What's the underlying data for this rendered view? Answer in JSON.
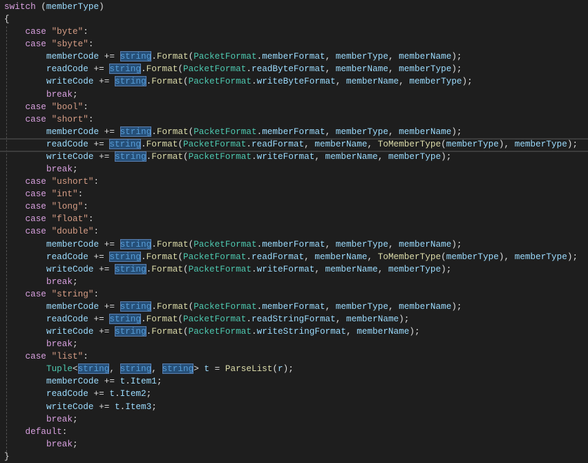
{
  "editor": {
    "lines": [
      {
        "i": 0,
        "t": [
          [
            "switch",
            "kw"
          ],
          [
            " (",
            "p"
          ],
          [
            "memberType",
            "var"
          ],
          [
            ")",
            "p"
          ]
        ]
      },
      {
        "i": 0,
        "t": [
          [
            "{",
            "p"
          ]
        ]
      },
      {
        "i": 4,
        "t": [
          [
            "case",
            "kw"
          ],
          [
            " ",
            "p"
          ],
          [
            "\"byte\"",
            "str"
          ],
          [
            ":",
            "p"
          ]
        ]
      },
      {
        "i": 4,
        "t": [
          [
            "case",
            "kw"
          ],
          [
            " ",
            "p"
          ],
          [
            "\"sbyte\"",
            "str"
          ],
          [
            ":",
            "p"
          ]
        ]
      },
      {
        "i": 8,
        "t": [
          [
            "memberCode",
            "var"
          ],
          [
            " += ",
            "p"
          ],
          [
            "string",
            "hl"
          ],
          [
            ".",
            "p"
          ],
          [
            "Format",
            "fn"
          ],
          [
            "(",
            "p"
          ],
          [
            "PacketFormat",
            "type"
          ],
          [
            ".",
            "p"
          ],
          [
            "memberFormat",
            "var"
          ],
          [
            ", ",
            "p"
          ],
          [
            "memberType",
            "var"
          ],
          [
            ", ",
            "p"
          ],
          [
            "memberName",
            "var"
          ],
          [
            ");",
            "p"
          ]
        ]
      },
      {
        "i": 8,
        "t": [
          [
            "readCode",
            "var"
          ],
          [
            " += ",
            "p"
          ],
          [
            "string",
            "hl"
          ],
          [
            ".",
            "p"
          ],
          [
            "Format",
            "fn"
          ],
          [
            "(",
            "p"
          ],
          [
            "PacketFormat",
            "type"
          ],
          [
            ".",
            "p"
          ],
          [
            "readByteFormat",
            "var"
          ],
          [
            ", ",
            "p"
          ],
          [
            "memberName",
            "var"
          ],
          [
            ", ",
            "p"
          ],
          [
            "memberType",
            "var"
          ],
          [
            ");",
            "p"
          ]
        ]
      },
      {
        "i": 8,
        "t": [
          [
            "writeCode",
            "var"
          ],
          [
            " += ",
            "p"
          ],
          [
            "string",
            "hl"
          ],
          [
            ".",
            "p"
          ],
          [
            "Format",
            "fn"
          ],
          [
            "(",
            "p"
          ],
          [
            "PacketFormat",
            "type"
          ],
          [
            ".",
            "p"
          ],
          [
            "writeByteFormat",
            "var"
          ],
          [
            ", ",
            "p"
          ],
          [
            "memberName",
            "var"
          ],
          [
            ", ",
            "p"
          ],
          [
            "memberType",
            "var"
          ],
          [
            ");",
            "p"
          ]
        ]
      },
      {
        "i": 8,
        "t": [
          [
            "break",
            "kw"
          ],
          [
            ";",
            "p"
          ]
        ]
      },
      {
        "i": 4,
        "t": [
          [
            "case",
            "kw"
          ],
          [
            " ",
            "p"
          ],
          [
            "\"bool\"",
            "str"
          ],
          [
            ":",
            "p"
          ]
        ]
      },
      {
        "i": 4,
        "t": [
          [
            "case",
            "kw"
          ],
          [
            " ",
            "p"
          ],
          [
            "\"short\"",
            "str"
          ],
          [
            ":",
            "p"
          ]
        ]
      },
      {
        "i": 8,
        "t": [
          [
            "memberCode",
            "var"
          ],
          [
            " += ",
            "p"
          ],
          [
            "string",
            "hl"
          ],
          [
            ".",
            "p"
          ],
          [
            "Format",
            "fn"
          ],
          [
            "(",
            "p"
          ],
          [
            "PacketFormat",
            "type"
          ],
          [
            ".",
            "p"
          ],
          [
            "memberFormat",
            "var"
          ],
          [
            ", ",
            "p"
          ],
          [
            "memberType",
            "var"
          ],
          [
            ", ",
            "p"
          ],
          [
            "memberName",
            "var"
          ],
          [
            ");",
            "p"
          ]
        ]
      },
      {
        "i": 8,
        "cur": true,
        "t": [
          [
            "readCode",
            "var"
          ],
          [
            " += ",
            "p"
          ],
          [
            "string",
            "hl"
          ],
          [
            ".",
            "p"
          ],
          [
            "Format",
            "fn"
          ],
          [
            "(",
            "p"
          ],
          [
            "PacketFormat",
            "type"
          ],
          [
            ".",
            "p"
          ],
          [
            "readFormat",
            "var"
          ],
          [
            ", ",
            "p"
          ],
          [
            "memberName",
            "var"
          ],
          [
            ", ",
            "p"
          ],
          [
            "ToMemberType",
            "fn"
          ],
          [
            "(",
            "p"
          ],
          [
            "memberType",
            "var"
          ],
          [
            "), ",
            "p"
          ],
          [
            "memberType",
            "var"
          ],
          [
            ");",
            "p"
          ]
        ]
      },
      {
        "i": 8,
        "t": [
          [
            "writeCode",
            "var"
          ],
          [
            " += ",
            "p"
          ],
          [
            "string",
            "hl"
          ],
          [
            ".",
            "p"
          ],
          [
            "Format",
            "fn"
          ],
          [
            "(",
            "p"
          ],
          [
            "PacketFormat",
            "type"
          ],
          [
            ".",
            "p"
          ],
          [
            "writeFormat",
            "var"
          ],
          [
            ", ",
            "p"
          ],
          [
            "memberName",
            "var"
          ],
          [
            ", ",
            "p"
          ],
          [
            "memberType",
            "var"
          ],
          [
            ");",
            "p"
          ]
        ]
      },
      {
        "i": 8,
        "t": [
          [
            "break",
            "kw"
          ],
          [
            ";",
            "p"
          ]
        ]
      },
      {
        "i": 4,
        "t": [
          [
            "case",
            "kw"
          ],
          [
            " ",
            "p"
          ],
          [
            "\"ushort\"",
            "str"
          ],
          [
            ":",
            "p"
          ]
        ]
      },
      {
        "i": 4,
        "t": [
          [
            "case",
            "kw"
          ],
          [
            " ",
            "p"
          ],
          [
            "\"int\"",
            "str"
          ],
          [
            ":",
            "p"
          ]
        ]
      },
      {
        "i": 4,
        "t": [
          [
            "case",
            "kw"
          ],
          [
            " ",
            "p"
          ],
          [
            "\"long\"",
            "str"
          ],
          [
            ":",
            "p"
          ]
        ]
      },
      {
        "i": 4,
        "t": [
          [
            "case",
            "kw"
          ],
          [
            " ",
            "p"
          ],
          [
            "\"float\"",
            "str"
          ],
          [
            ":",
            "p"
          ]
        ]
      },
      {
        "i": 4,
        "t": [
          [
            "case",
            "kw"
          ],
          [
            " ",
            "p"
          ],
          [
            "\"double\"",
            "str"
          ],
          [
            ":",
            "p"
          ]
        ]
      },
      {
        "i": 8,
        "t": [
          [
            "memberCode",
            "var"
          ],
          [
            " += ",
            "p"
          ],
          [
            "string",
            "hl"
          ],
          [
            ".",
            "p"
          ],
          [
            "Format",
            "fn"
          ],
          [
            "(",
            "p"
          ],
          [
            "PacketFormat",
            "type"
          ],
          [
            ".",
            "p"
          ],
          [
            "memberFormat",
            "var"
          ],
          [
            ", ",
            "p"
          ],
          [
            "memberType",
            "var"
          ],
          [
            ", ",
            "p"
          ],
          [
            "memberName",
            "var"
          ],
          [
            ");",
            "p"
          ]
        ]
      },
      {
        "i": 8,
        "t": [
          [
            "readCode",
            "var"
          ],
          [
            " += ",
            "p"
          ],
          [
            "string",
            "hl"
          ],
          [
            ".",
            "p"
          ],
          [
            "Format",
            "fn"
          ],
          [
            "(",
            "p"
          ],
          [
            "PacketFormat",
            "type"
          ],
          [
            ".",
            "p"
          ],
          [
            "readFormat",
            "var"
          ],
          [
            ", ",
            "p"
          ],
          [
            "memberName",
            "var"
          ],
          [
            ", ",
            "p"
          ],
          [
            "ToMemberType",
            "fn"
          ],
          [
            "(",
            "p"
          ],
          [
            "memberType",
            "var"
          ],
          [
            "), ",
            "p"
          ],
          [
            "memberType",
            "var"
          ],
          [
            ");",
            "p"
          ]
        ]
      },
      {
        "i": 8,
        "t": [
          [
            "writeCode",
            "var"
          ],
          [
            " += ",
            "p"
          ],
          [
            "string",
            "hl"
          ],
          [
            ".",
            "p"
          ],
          [
            "Format",
            "fn"
          ],
          [
            "(",
            "p"
          ],
          [
            "PacketFormat",
            "type"
          ],
          [
            ".",
            "p"
          ],
          [
            "writeFormat",
            "var"
          ],
          [
            ", ",
            "p"
          ],
          [
            "memberName",
            "var"
          ],
          [
            ", ",
            "p"
          ],
          [
            "memberType",
            "var"
          ],
          [
            ");",
            "p"
          ]
        ]
      },
      {
        "i": 8,
        "t": [
          [
            "break",
            "kw"
          ],
          [
            ";",
            "p"
          ]
        ]
      },
      {
        "i": 4,
        "t": [
          [
            "case",
            "kw"
          ],
          [
            " ",
            "p"
          ],
          [
            "\"string\"",
            "str"
          ],
          [
            ":",
            "p"
          ]
        ]
      },
      {
        "i": 8,
        "t": [
          [
            "memberCode",
            "var"
          ],
          [
            " += ",
            "p"
          ],
          [
            "string",
            "hl"
          ],
          [
            ".",
            "p"
          ],
          [
            "Format",
            "fn"
          ],
          [
            "(",
            "p"
          ],
          [
            "PacketFormat",
            "type"
          ],
          [
            ".",
            "p"
          ],
          [
            "memberFormat",
            "var"
          ],
          [
            ", ",
            "p"
          ],
          [
            "memberType",
            "var"
          ],
          [
            ", ",
            "p"
          ],
          [
            "memberName",
            "var"
          ],
          [
            ");",
            "p"
          ]
        ]
      },
      {
        "i": 8,
        "t": [
          [
            "readCode",
            "var"
          ],
          [
            " += ",
            "p"
          ],
          [
            "string",
            "hl"
          ],
          [
            ".",
            "p"
          ],
          [
            "Format",
            "fn"
          ],
          [
            "(",
            "p"
          ],
          [
            "PacketFormat",
            "type"
          ],
          [
            ".",
            "p"
          ],
          [
            "readStringFormat",
            "var"
          ],
          [
            ", ",
            "p"
          ],
          [
            "memberName",
            "var"
          ],
          [
            ");",
            "p"
          ]
        ]
      },
      {
        "i": 8,
        "t": [
          [
            "writeCode",
            "var"
          ],
          [
            " += ",
            "p"
          ],
          [
            "string",
            "hl"
          ],
          [
            ".",
            "p"
          ],
          [
            "Format",
            "fn"
          ],
          [
            "(",
            "p"
          ],
          [
            "PacketFormat",
            "type"
          ],
          [
            ".",
            "p"
          ],
          [
            "writeStringFormat",
            "var"
          ],
          [
            ", ",
            "p"
          ],
          [
            "memberName",
            "var"
          ],
          [
            ");",
            "p"
          ]
        ]
      },
      {
        "i": 8,
        "t": [
          [
            "break",
            "kw"
          ],
          [
            ";",
            "p"
          ]
        ]
      },
      {
        "i": 4,
        "t": [
          [
            "case",
            "kw"
          ],
          [
            " ",
            "p"
          ],
          [
            "\"list\"",
            "str"
          ],
          [
            ":",
            "p"
          ]
        ]
      },
      {
        "i": 8,
        "t": [
          [
            "Tuple",
            "type"
          ],
          [
            "<",
            "p"
          ],
          [
            "string",
            "hl"
          ],
          [
            ", ",
            "p"
          ],
          [
            "string",
            "hl"
          ],
          [
            ", ",
            "p"
          ],
          [
            "string",
            "hl"
          ],
          [
            "> ",
            "p"
          ],
          [
            "t",
            "var"
          ],
          [
            " = ",
            "p"
          ],
          [
            "ParseList",
            "fn"
          ],
          [
            "(",
            "p"
          ],
          [
            "r",
            "var"
          ],
          [
            ");",
            "p"
          ]
        ]
      },
      {
        "i": 8,
        "t": [
          [
            "memberCode",
            "var"
          ],
          [
            " += ",
            "p"
          ],
          [
            "t",
            "var"
          ],
          [
            ".",
            "p"
          ],
          [
            "Item1",
            "var"
          ],
          [
            ";",
            "p"
          ]
        ]
      },
      {
        "i": 8,
        "t": [
          [
            "readCode",
            "var"
          ],
          [
            " += ",
            "p"
          ],
          [
            "t",
            "var"
          ],
          [
            ".",
            "p"
          ],
          [
            "Item2",
            "var"
          ],
          [
            ";",
            "p"
          ]
        ]
      },
      {
        "i": 8,
        "t": [
          [
            "writeCode",
            "var"
          ],
          [
            " += ",
            "p"
          ],
          [
            "t",
            "var"
          ],
          [
            ".",
            "p"
          ],
          [
            "Item3",
            "var"
          ],
          [
            ";",
            "p"
          ]
        ]
      },
      {
        "i": 8,
        "t": [
          [
            "break",
            "kw"
          ],
          [
            ";",
            "p"
          ]
        ]
      },
      {
        "i": 4,
        "t": [
          [
            "default",
            "kw"
          ],
          [
            ":",
            "p"
          ]
        ]
      },
      {
        "i": 8,
        "t": [
          [
            "break",
            "kw"
          ],
          [
            ";",
            "p"
          ]
        ]
      },
      {
        "i": 0,
        "t": [
          [
            "}",
            "p"
          ]
        ]
      }
    ]
  }
}
